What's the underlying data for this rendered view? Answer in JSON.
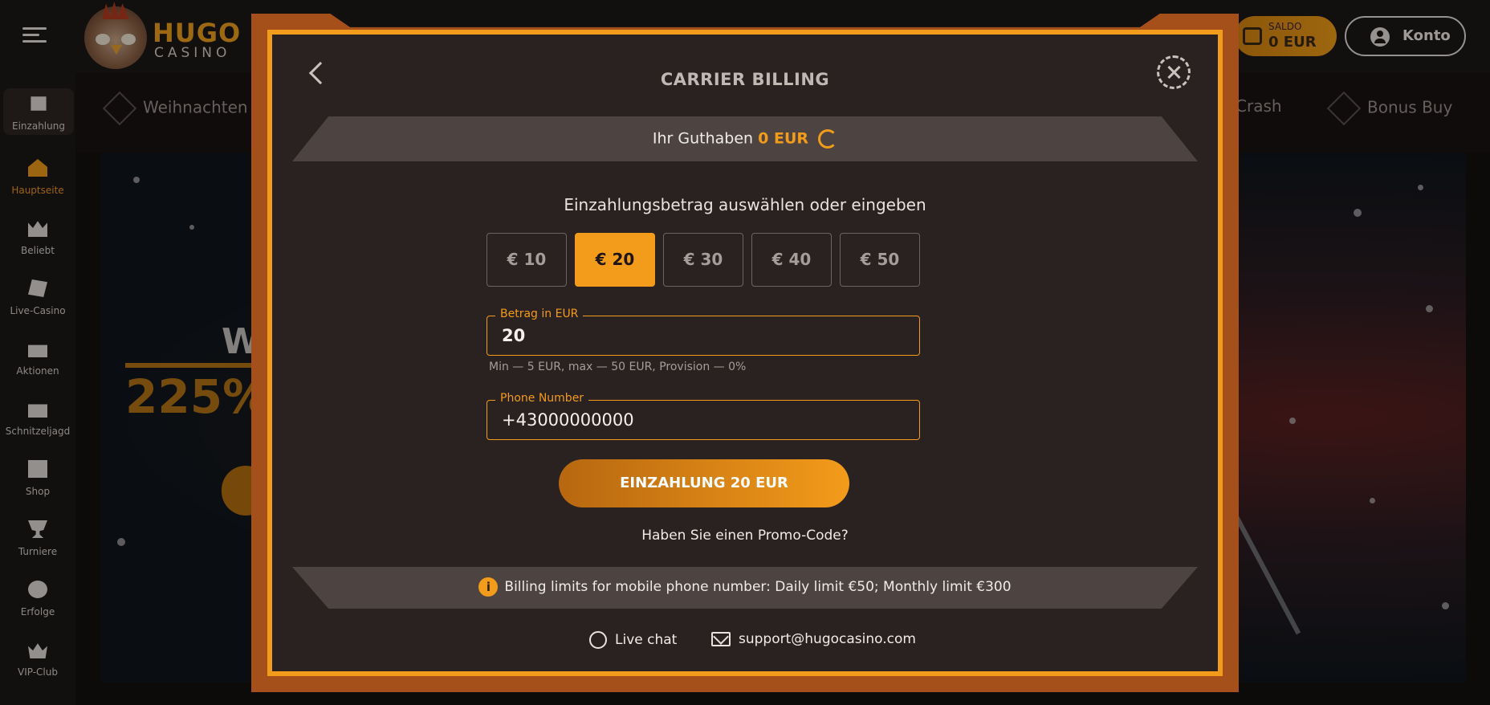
{
  "header": {
    "brand_name": "HUGO",
    "brand_sub": "CASINO",
    "balance_label": "SALDO",
    "balance_value": "0 EUR",
    "account_label": "Konto"
  },
  "sidebar": {
    "items": [
      {
        "label": "Einzahlung",
        "icon": "wallet-icon"
      },
      {
        "label": "Hauptseite",
        "icon": "home-icon",
        "active": true
      },
      {
        "label": "Beliebt",
        "icon": "crown-icon"
      },
      {
        "label": "Live-Casino",
        "icon": "cards-icon"
      },
      {
        "label": "Aktionen",
        "icon": "gift-icon"
      },
      {
        "label": "Schnitzeljagd",
        "icon": "chest-icon"
      },
      {
        "label": "Shop",
        "icon": "shop-icon"
      },
      {
        "label": "Turniere",
        "icon": "trophy-icon"
      },
      {
        "label": "Erfolge",
        "icon": "medal-icon"
      },
      {
        "label": "VIP-Club",
        "icon": "vip-crown-icon"
      }
    ]
  },
  "categories": [
    {
      "label": "Weihnachten"
    },
    {
      "label": "Crash"
    },
    {
      "label": "Bonus Buy"
    }
  ],
  "banner": {
    "headline_partial": "Wil",
    "percent_partial": "225%"
  },
  "modal": {
    "title": "CARRIER BILLING",
    "balance_prefix": "Ihr Guthaben",
    "balance_amount": "0 EUR",
    "choose_label": "Einzahlungsbetrag auswählen oder eingeben",
    "amounts": [
      "€ 10",
      "€ 20",
      "€ 30",
      "€ 40",
      "€ 50"
    ],
    "selected_amount": "€ 20",
    "amount_field": {
      "label": "Betrag in EUR",
      "value": "20"
    },
    "hint": "Min — 5 EUR, max — 50 EUR, Provision — 0%",
    "phone_field": {
      "label": "Phone Number",
      "value": "+43000000000"
    },
    "deposit_button": "EINZAHLUNG 20 EUR",
    "promo_link": "Haben Sie einen Promo-Code?",
    "limits": "Billing limits for mobile phone number: Daily limit €50; Monthly limit €300",
    "live_chat": "Live chat",
    "support_email": "support@hugocasino.com"
  },
  "colors": {
    "accent": "#f39b1a",
    "modal_bg": "#2a2220",
    "frame": "#a5501b"
  }
}
